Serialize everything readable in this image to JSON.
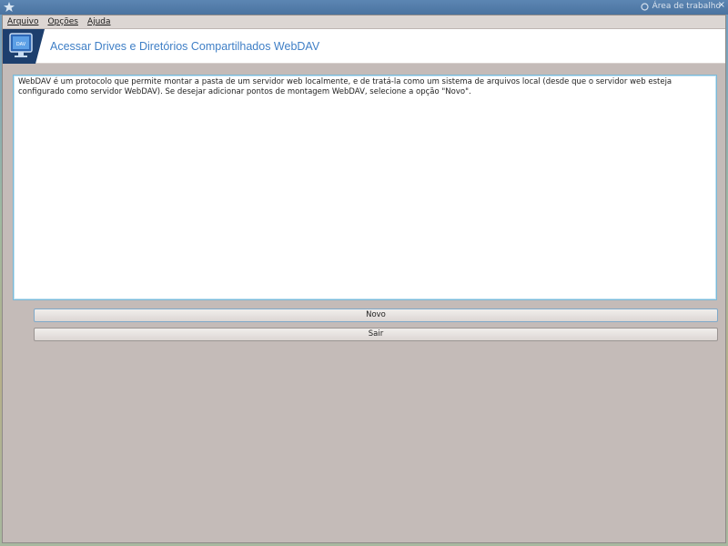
{
  "titlebar": {
    "workspace_label": "Área de trabalho",
    "close_glyph": "×",
    "app_icon": "mandriva-star-icon"
  },
  "menubar": {
    "items": [
      {
        "label": "Arquivo"
      },
      {
        "label": "Opções"
      },
      {
        "label": "Ajuda"
      }
    ]
  },
  "banner": {
    "icon": "webdav-monitor-icon",
    "icon_text": "DAV",
    "title": "Acessar Drives e Diretórios Compartilhados WebDAV",
    "title_color": "#3f7fc6"
  },
  "main": {
    "description": "WebDAV é um protocolo que permite montar a pasta de um servidor web localmente, e de tratá-la como um sistema de arquivos local (desde que o servidor web esteja configurado como servidor WebDAV). Se desejar adicionar pontos de montagem WebDAV, selecione a opção \"Novo\".",
    "buttons": {
      "new_label": "Novo",
      "quit_label": "Sair"
    }
  },
  "colors": {
    "window_bg": "#c4bbb8",
    "accent_border": "#79b8d8"
  }
}
